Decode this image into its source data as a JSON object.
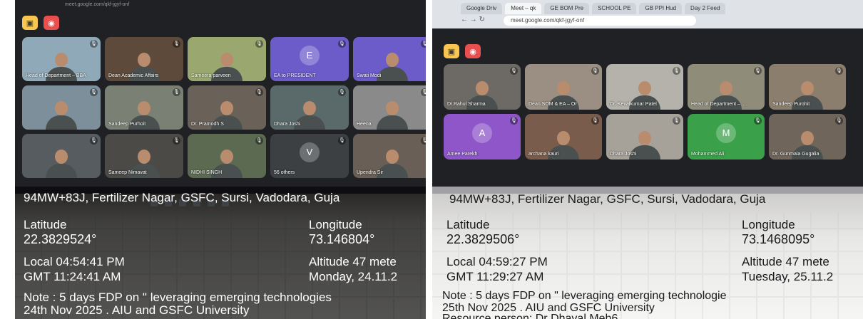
{
  "photos": [
    {
      "url": "meet.google.com/qkf-jgyf-onf",
      "tiles": [
        {
          "name": "Head of Department – BBA",
          "type": "video",
          "color": "#8fa9b8"
        },
        {
          "name": "Dean Academic Affairs",
          "type": "video",
          "color": "#5d4a3a"
        },
        {
          "name": "Sameera parveen",
          "type": "video",
          "color": "#9aa870"
        },
        {
          "name": "EA to PRESIDENT",
          "type": "avatar",
          "initial": "E",
          "color": "#6b5cc9"
        },
        {
          "name": "Swati Modi",
          "type": "video",
          "color": "#6b5cc9"
        },
        {
          "name": "",
          "type": "video",
          "color": "#7d8f9a"
        },
        {
          "name": "Sandeep Purhoit",
          "type": "video",
          "color": "#7a8074"
        },
        {
          "name": "Dr. Pramodh S",
          "type": "video",
          "color": "#6a6258"
        },
        {
          "name": "Dhara Joshi",
          "type": "video",
          "color": "#5a6a6a"
        },
        {
          "name": "Heena",
          "type": "video",
          "color": "#8a8a8a"
        },
        {
          "name": "",
          "type": "video",
          "color": "#565c60"
        },
        {
          "name": "Sameep Nimavat",
          "type": "video",
          "color": "#4b4a47"
        },
        {
          "name": "NIDHI SINGH",
          "type": "video",
          "color": "#5c6a52"
        },
        {
          "name": "56 others",
          "type": "others",
          "initial": "V",
          "color": "#3c4043"
        },
        {
          "name": "Upendra Sir",
          "type": "video",
          "color": "#6a5f56"
        }
      ],
      "caption": {
        "address": "94MW+83J, Fertilizer Nagar, GSFC, Sursi, Vadodara, Guja",
        "latitude_label": "Latitude",
        "latitude": "22.3829524°",
        "longitude_label": "Longitude",
        "longitude": "73.146804°",
        "local": "Local 04:54:41 PM",
        "gmt": "GMT 11:24:41 AM",
        "altitude": "Altitude 47 mete",
        "day": "Monday, 24.11.2",
        "note_line1": "Note : 5 days FDP on \" leveraging emerging technologies",
        "note_line2": "24th Nov 2025 . AIU and GSFC University",
        "note_line3": ""
      }
    },
    {
      "url": "meet.google.com/qkf-jgyf-onf",
      "tabs": [
        "Google Driv",
        "Meet – qk",
        "GE BOM Pre",
        "SCHOOL PE",
        "GB PPI Hud",
        "Day 2 Feed"
      ],
      "tiles": [
        {
          "name": "Dr.Rahul Sharma",
          "type": "video",
          "color": "#6d6a66"
        },
        {
          "name": "Dean SOM & EA – Or",
          "type": "video",
          "color": "#9a8f82"
        },
        {
          "name": "Dr. Kevalkumar Patel",
          "type": "video",
          "color": "#b5b2ab"
        },
        {
          "name": "Head of Department – ...",
          "type": "video",
          "color": "#8f8c7a"
        },
        {
          "name": "Sandeep Purohit",
          "type": "video",
          "color": "#8b7e6d"
        },
        {
          "name": "Amee Parekh",
          "type": "avatar",
          "initial": "A",
          "color": "#8e56c9"
        },
        {
          "name": "archana kauri",
          "type": "video",
          "color": "#7a5c4c"
        },
        {
          "name": "Dhara Joshi",
          "type": "video",
          "color": "#a6a29a"
        },
        {
          "name": "Mohammed Ali",
          "type": "avatar",
          "initial": "M",
          "color": "#3aa04a"
        },
        {
          "name": "Dr. Gunmala Gugalia",
          "type": "video",
          "color": "#6f655a"
        }
      ],
      "caption": {
        "address": "94MW+83J, Fertilizer Nagar, GSFC, Sursi, Vadodara, Guja",
        "latitude_label": "Latitude",
        "latitude": "22.3829506°",
        "longitude_label": "Longitude",
        "longitude": "73.1468095°",
        "local": "Local 04:59:27 PM",
        "gmt": "GMT 11:29:27 AM",
        "altitude": "Altitude 47 mete",
        "day": "Tuesday, 25.11.2",
        "note_line1": "Note : 5 days FDP on \" leveraging emerging technologie",
        "note_line2": "25th Nov 2025 . AIU and GSFC University",
        "note_line3": "Resource person: Dr Dhaval Meh6"
      }
    }
  ]
}
